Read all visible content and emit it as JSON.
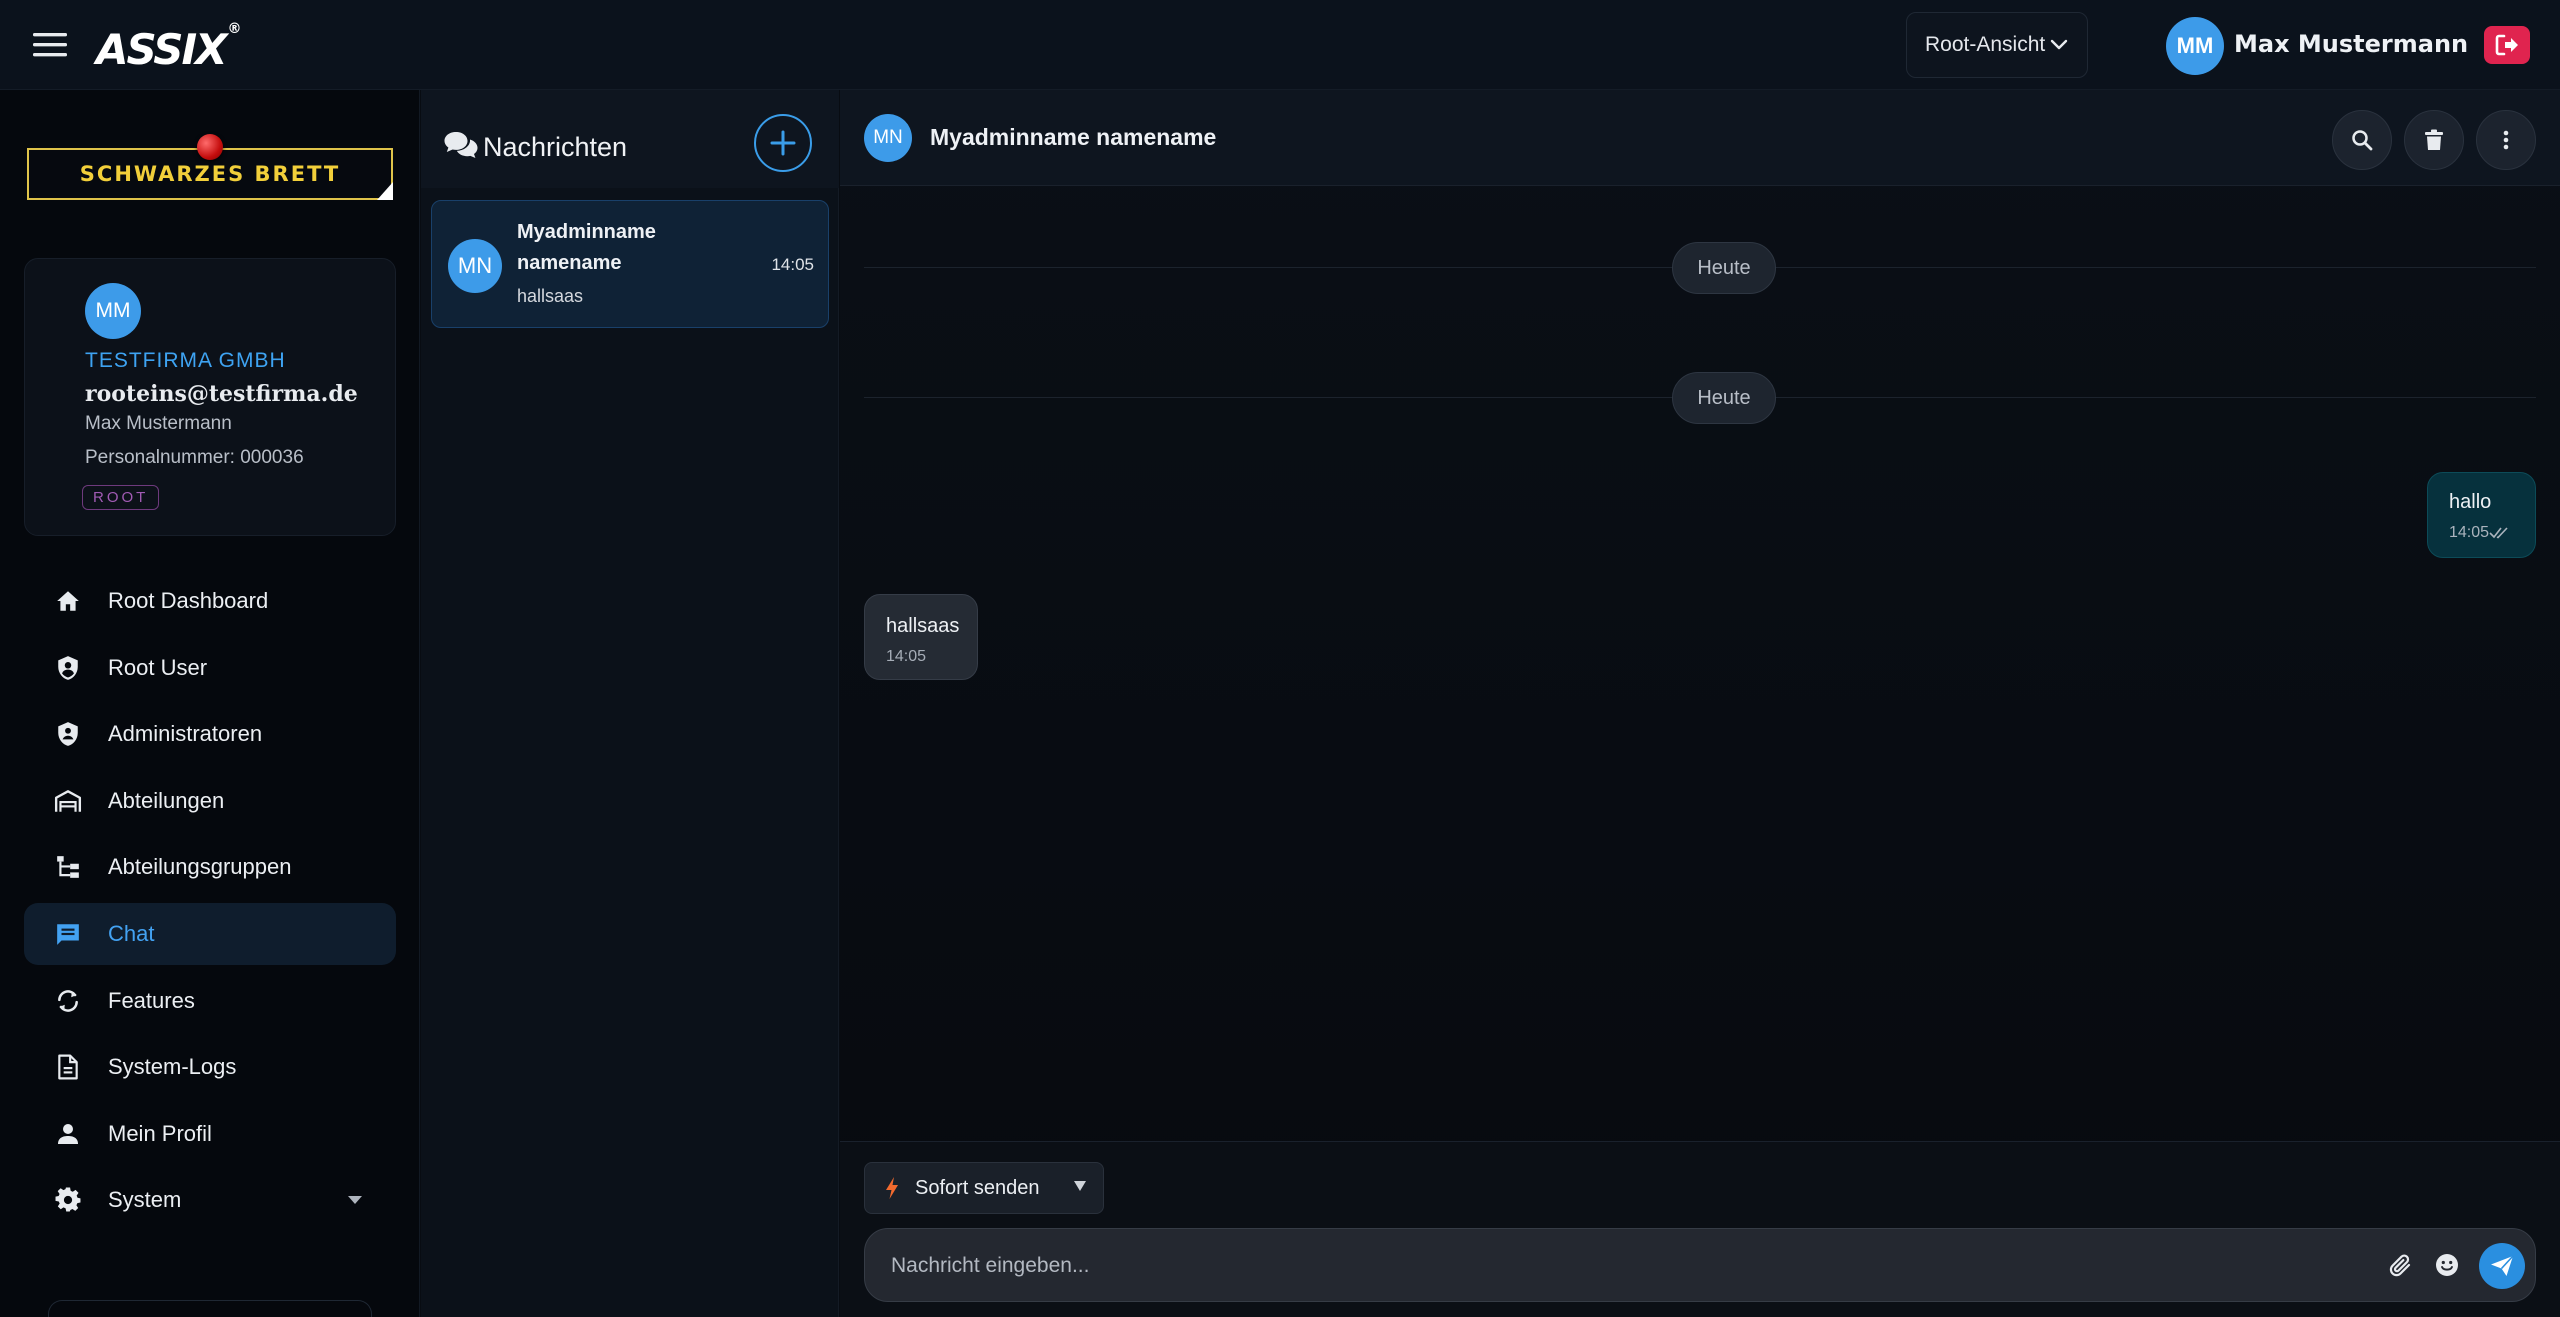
{
  "app": {
    "logo_text": "ASSIX",
    "logo_mark": "®"
  },
  "header": {
    "view_select": "Root-Ansicht",
    "user_initials": "MM",
    "user_name": "Max Mustermann"
  },
  "sidebar": {
    "board_label": "SCHWARZES BRETT",
    "profile": {
      "initials": "MM",
      "company": "TESTFIRMA GMBH",
      "email": "rooteins@testfirma.de",
      "name": "Max Mustermann",
      "personnel_number": "Personalnummer: 000036",
      "role_badge": "ROOT"
    },
    "items": [
      {
        "label": "Root Dashboard",
        "icon": "home-icon"
      },
      {
        "label": "Root User",
        "icon": "shield-user-icon"
      },
      {
        "label": "Administratoren",
        "icon": "shield-admin-icon"
      },
      {
        "label": "Abteilungen",
        "icon": "building-icon"
      },
      {
        "label": "Abteilungsgruppen",
        "icon": "hierarchy-icon"
      },
      {
        "label": "Chat",
        "icon": "chat-icon",
        "active": true
      },
      {
        "label": "Features",
        "icon": "sync-icon"
      },
      {
        "label": "System-Logs",
        "icon": "document-icon"
      },
      {
        "label": "Mein Profil",
        "icon": "person-icon"
      },
      {
        "label": "System",
        "icon": "gear-icon",
        "expandable": true
      }
    ]
  },
  "conversations": {
    "title": "Nachrichten",
    "items": [
      {
        "initials": "MN",
        "name": "Myadminname namename",
        "time": "14:05",
        "preview": "hallsaas",
        "selected": true
      }
    ]
  },
  "chat": {
    "header": {
      "initials": "MN",
      "name": "Myadminname namename"
    },
    "day_dividers": [
      "Heute",
      "Heute"
    ],
    "messages": [
      {
        "direction": "out",
        "text": "hallo",
        "time": "14:05",
        "status": "read"
      },
      {
        "direction": "in",
        "text": "hallsaas",
        "time": "14:05"
      }
    ],
    "composer": {
      "send_mode": "Sofort senden",
      "placeholder": "Nachricht eingeben..."
    }
  },
  "colors": {
    "accent": "#3d9be9",
    "logout": "#e0244f",
    "board_yellow": "#f2cf3a",
    "root_badge": "#a15bb4",
    "bolt": "#f26a2e"
  }
}
